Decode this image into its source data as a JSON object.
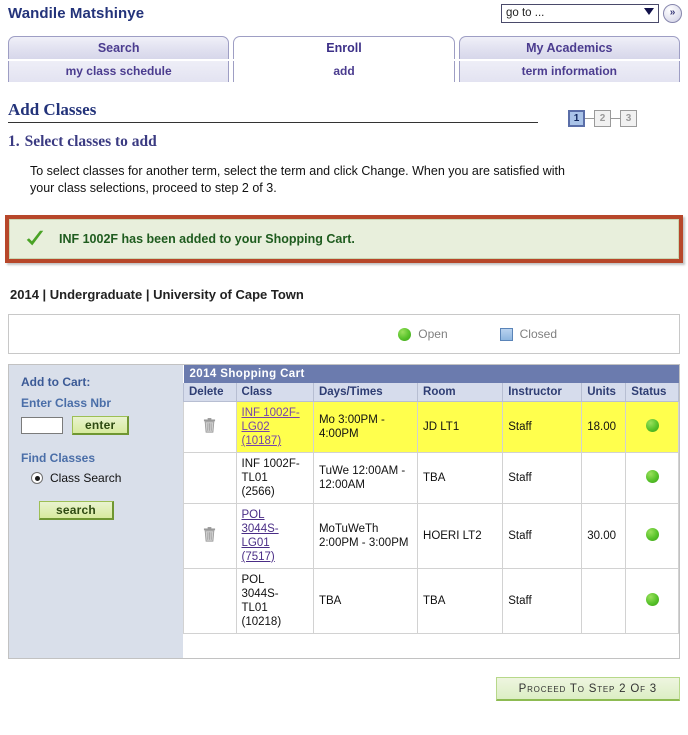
{
  "header": {
    "user_name": "Wandile Matshinye",
    "goto_select_value": "go to ...",
    "goto_button_label": "»"
  },
  "tabs": {
    "main": [
      {
        "label": "Search",
        "active": false
      },
      {
        "label": "Enroll",
        "active": true
      },
      {
        "label": "My Academics",
        "active": false
      }
    ],
    "sub": [
      {
        "label": "my class schedule",
        "active": false
      },
      {
        "label": "add",
        "active": true
      },
      {
        "label": "term information",
        "active": false
      }
    ]
  },
  "page": {
    "title": "Add Classes",
    "step_number": "1.",
    "step_title": "Select classes to add",
    "instructions": "To select classes for another term, select the term and click Change.  When you are satisfied with your class selections, proceed to step 2 of 3.",
    "steps": [
      {
        "label": "1",
        "state": "current"
      },
      {
        "label": "2",
        "state": "inactive"
      },
      {
        "label": "3",
        "state": "inactive"
      }
    ]
  },
  "banner": {
    "icon": "green-check-icon",
    "message": "INF 1002F has been added to your Shopping Cart.",
    "highlight_border_color": "#b7472a",
    "background_color": "#e8efdc"
  },
  "term_line": "2014 | Undergraduate | University of Cape Town",
  "legend": [
    {
      "label": "Open",
      "marker": "green-circle",
      "color": "#57c22a"
    },
    {
      "label": "Closed",
      "marker": "blue-square",
      "color": "#8eb6e0"
    }
  ],
  "sidebar": {
    "add_to_cart_label": "Add to Cart:",
    "enter_class_nbr_label": "Enter Class Nbr",
    "class_nbr_value": "",
    "enter_button_label": "enter",
    "find_classes_label": "Find Classes",
    "class_search_label": "Class Search",
    "class_search_selected": true,
    "search_button_label": "search"
  },
  "cart": {
    "group_title": "2014 Shopping Cart",
    "columns": [
      "Delete",
      "Class",
      "Days/Times",
      "Room",
      "Instructor",
      "Units",
      "Status"
    ],
    "rows": [
      {
        "delete_icon": "trash-icon",
        "has_delete": true,
        "class_lines": [
          "INF 1002F-",
          "LG02",
          "(10187)"
        ],
        "class_is_link": true,
        "link_state": "active",
        "days_times": "Mo 3:00PM - 4:00PM",
        "room": "JD LT1",
        "instructor": "Staff",
        "units": "18.00",
        "status": "open",
        "highlighted": true
      },
      {
        "delete_icon": "",
        "has_delete": false,
        "class_lines": [
          "INF 1002F-",
          "TL01",
          "(2566)"
        ],
        "class_is_link": false,
        "link_state": "",
        "days_times": "TuWe 12:00AM - 12:00AM",
        "room": "TBA",
        "instructor": "Staff",
        "units": "",
        "status": "open",
        "highlighted": false
      },
      {
        "delete_icon": "trash-icon",
        "has_delete": true,
        "class_lines": [
          "POL",
          "3044S-",
          "LG01",
          "(7517)"
        ],
        "class_is_link": true,
        "link_state": "visited",
        "days_times": "MoTuWeTh 2:00PM - 3:00PM",
        "room": "HOERI LT2",
        "instructor": "Staff",
        "units": "30.00",
        "status": "open",
        "highlighted": false
      },
      {
        "delete_icon": "",
        "has_delete": false,
        "class_lines": [
          "POL",
          "3044S-",
          "TL01",
          "(10218)"
        ],
        "class_is_link": false,
        "link_state": "",
        "days_times": "TBA",
        "room": "TBA",
        "instructor": "Staff",
        "units": "",
        "status": "open",
        "highlighted": false
      }
    ]
  },
  "footer": {
    "proceed_label": "Proceed To Step 2 Of 3"
  }
}
